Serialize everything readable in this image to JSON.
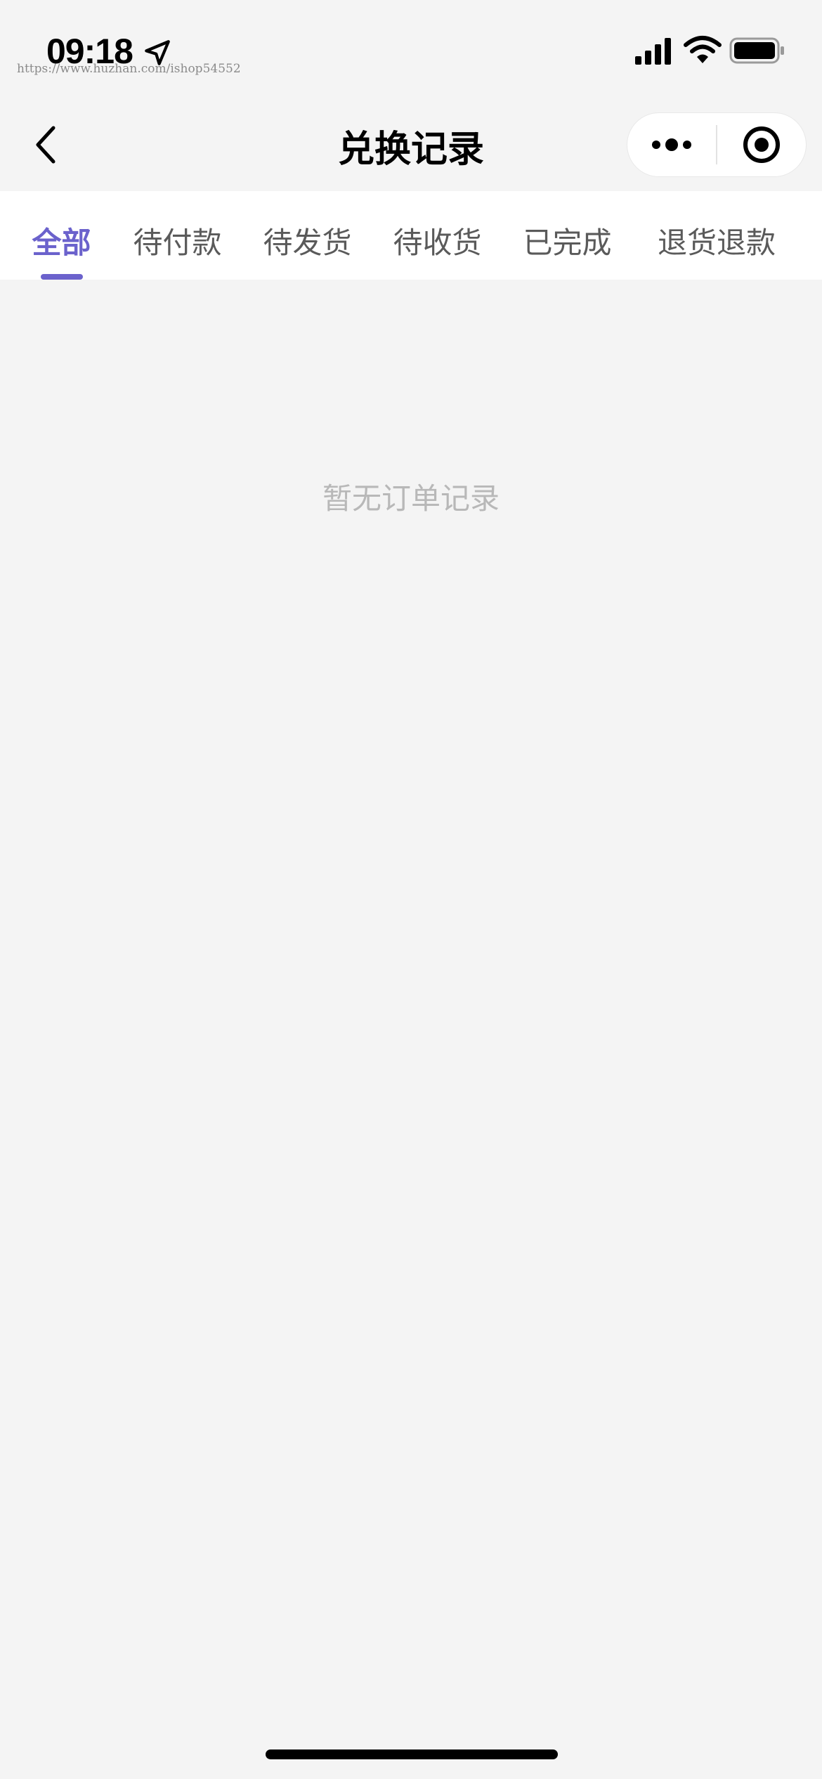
{
  "status_bar": {
    "time": "09:18",
    "watermark": "https://www.huzhan.com/ishop54552",
    "icons": [
      "location-arrow-icon",
      "cellular-signal-icon",
      "wifi-icon",
      "battery-icon"
    ]
  },
  "nav": {
    "back_icon": "chevron-left-icon",
    "title": "兑换记录",
    "capsule": {
      "more_icon": "more-dots-icon",
      "close_icon": "target-circle-icon"
    }
  },
  "tabs": [
    {
      "label": "全部",
      "active": true
    },
    {
      "label": "待付款",
      "active": false
    },
    {
      "label": "待发货",
      "active": false
    },
    {
      "label": "待收货",
      "active": false
    },
    {
      "label": "已完成",
      "active": false
    },
    {
      "label": "退货退款",
      "active": false
    }
  ],
  "empty_state": {
    "message": "暂无订单记录"
  },
  "colors": {
    "accent": "#6b62cc",
    "background": "#f4f4f4",
    "tab_text": "#5a5a5a",
    "empty_text": "#b8b8b8"
  }
}
